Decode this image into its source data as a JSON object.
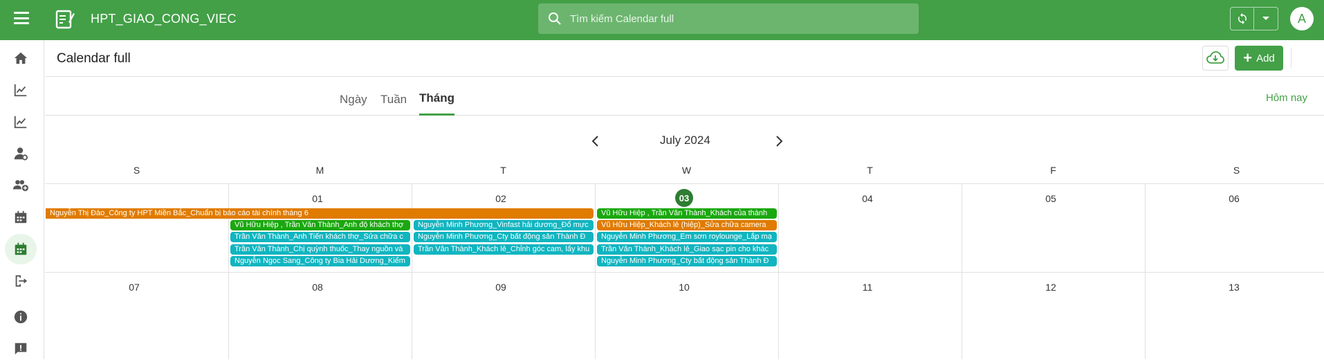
{
  "app": {
    "title": "HPT_GIAO_CONG_VIEC",
    "user_initial": "A"
  },
  "search": {
    "placeholder": "Tìm kiếm Calendar full"
  },
  "sidebar": {
    "items": [
      {
        "icon": "home-icon"
      },
      {
        "icon": "trending-icon"
      },
      {
        "icon": "trending-icon"
      },
      {
        "icon": "user-gear-icon"
      },
      {
        "icon": "add-group-icon"
      },
      {
        "icon": "calendar-icon"
      },
      {
        "icon": "calendar-active-icon",
        "active": true
      },
      {
        "icon": "logout-icon"
      },
      {
        "icon": "info-icon"
      },
      {
        "icon": "feedback-icon"
      }
    ]
  },
  "page": {
    "title": "Calendar full",
    "add_label": "Add"
  },
  "views": {
    "day": "Ngày",
    "week": "Tuần",
    "month": "Tháng",
    "today": "Hôm nay"
  },
  "calendar": {
    "month_label": "July 2024",
    "weekdays": [
      "S",
      "M",
      "T",
      "W",
      "T",
      "F",
      "S"
    ],
    "week1_days": [
      "",
      "01",
      "02",
      "03",
      "04",
      "05",
      "06"
    ],
    "week2_days": [
      "07",
      "08",
      "09",
      "10",
      "11",
      "12",
      "13"
    ],
    "today": "03",
    "events": {
      "span_event": "Nguyễn Thị Đào_Công ty HPT Miền Bắc_Chuẩn bị báo cáo tài chính tháng 6",
      "mon": [
        "Vũ Hữu Hiệp , Trần Văn Thành_Anh độ khách thợ",
        "Trần Văn Thành_Anh Tiến khách thợ_Sửa chữa c",
        "Trần Văn Thành_Chị quỳnh thuốc_Thay nguồn và",
        "Nguyễn Ngọc Sang_Công ty Bia Hải Dương_Kiểm"
      ],
      "tue": [
        "Nguyễn Minh Phương_Vinfast hải dương_Đổ mực",
        "Nguyễn Minh Phương_Cty bất động sản Thành Đ",
        "Trần Văn Thành_Khách lẻ_Chỉnh góc cam, lấy khu"
      ],
      "wed": [
        "Vũ Hữu Hiệp , Trần Văn Thành_Khách của thành",
        "Vũ Hữu Hiệp_Khách lẻ (hiệp)_Sửa chữa camera",
        "Nguyễn Minh Phương_Em sơn roylounge_Lắp mạ",
        "Trần Văn Thành_Khách lẻ_Giao sạc pin cho khác",
        "Nguyễn Minh Phương_Cty bất động sản Thành Đ"
      ]
    },
    "colors": {
      "orange": "#e07b00",
      "green": "#1aa80f",
      "teal": "#10b5c0",
      "accent": "#43a047"
    }
  }
}
